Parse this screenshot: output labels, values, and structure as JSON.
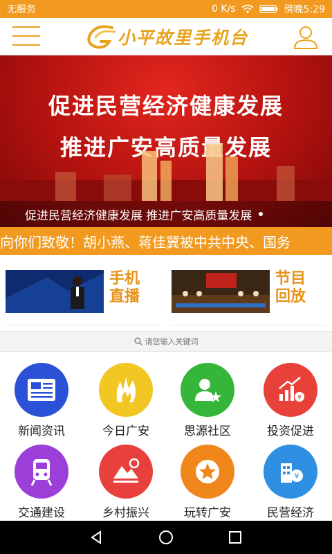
{
  "status": {
    "carrier": "无服务",
    "speed": "0 K/s",
    "time": "傍晚5:29"
  },
  "header": {
    "app_title": "小平故里手机台"
  },
  "banner": {
    "line1": "促进民营经济健康发展",
    "line2": "推进广安高质量发展",
    "caption": "促进民营经济健康发展 推进广安高质量发展"
  },
  "ticker": {
    "text": "向你们致敬！胡小燕、蒋佳冀被中共中央、国务"
  },
  "media": [
    {
      "label": "手机直播",
      "line1": "手机",
      "line2": "直播"
    },
    {
      "label": "节目回放",
      "line1": "节目",
      "line2": "回放"
    }
  ],
  "search": {
    "placeholder": "请您输入关键词"
  },
  "grid": [
    {
      "label": "新闻资讯",
      "icon": "newspaper-icon",
      "color": "#2b52d6"
    },
    {
      "label": "今日广安",
      "icon": "flame-icon",
      "color": "#f2c623"
    },
    {
      "label": "思源社区",
      "icon": "person-star-icon",
      "color": "#35b53a"
    },
    {
      "label": "投资促进",
      "icon": "growth-chart-icon",
      "color": "#e8413a"
    },
    {
      "label": "交通建设",
      "icon": "train-icon",
      "color": "#9b3fd8"
    },
    {
      "label": "乡村振兴",
      "icon": "mountain-icon",
      "color": "#e8403c"
    },
    {
      "label": "玩转广安",
      "icon": "star-badge-icon",
      "color": "#f0871c"
    },
    {
      "label": "民营经济",
      "icon": "building-yen-icon",
      "color": "#2e8fe3"
    }
  ]
}
